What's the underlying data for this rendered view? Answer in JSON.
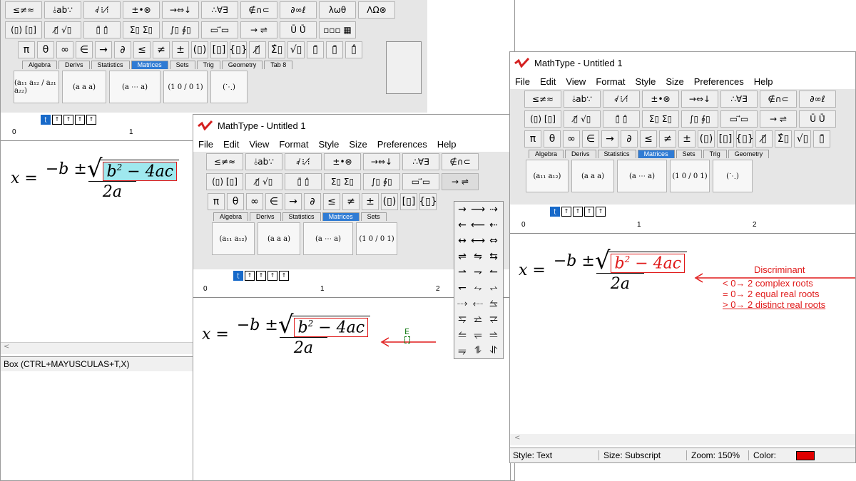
{
  "menu": [
    "File",
    "Edit",
    "View",
    "Format",
    "Style",
    "Size",
    "Preferences",
    "Help"
  ],
  "toolbar_row1": [
    "≤≠≈",
    "⫰ab∵",
    "⸗̸ ⁝ ⁝̸",
    "±•⊗",
    "→⇔↓",
    "∴∀∃",
    "∉∩⊂",
    "∂∞ℓ",
    "λωθ",
    "ΛΩ⊗"
  ],
  "toolbar_row2": [
    "(▯) [▯]",
    "▯̸ √▯",
    "▯̄ ▯̂",
    "Σ▯ Σ▯",
    "∫▯ ∮▯",
    "▭ ⃗▭",
    "→ ⇌",
    "Ū Ū̇",
    "▫▫▫ ▦"
  ],
  "toolbar_row3": [
    "π",
    "θ",
    "∞",
    "∈",
    "→",
    "∂",
    "≤",
    "≠",
    "±",
    "(▯)",
    "[▯]",
    "{▯}",
    "▯̸",
    "Σ̂▯",
    "√▯",
    "▯̄",
    "▯̄",
    "▯̂"
  ],
  "tabs": [
    "Algebra",
    "Derivs",
    "Statistics",
    "Matrices",
    "Sets",
    "Trig",
    "Geometry",
    "Tab 8"
  ],
  "active_tab": "Matrices",
  "equation": {
    "x": "x",
    "eq": "=",
    "neg_b": "−b ± ",
    "b": "b",
    "sup": "2",
    "rest": " − 4ac",
    "den": "2a"
  },
  "left_window": {
    "status": "Box (CTRL+MAYUSCULAS+T,X)"
  },
  "mid_window": {
    "title": "MathType - Untitled 1",
    "cursor_label": "E"
  },
  "right_window": {
    "title": "MathType - Untitled 1",
    "annotation_title": "Discriminant",
    "annotation_lines": [
      "< 0→ 2 complex roots",
      "= 0→ 2 equal real roots",
      "> 0→ 2 distinct real roots"
    ],
    "status": {
      "style": "Style: Text",
      "size": "Size: Subscript",
      "zoom": "Zoom: 150%",
      "color_label": "Color:"
    },
    "status_color": "#e00000"
  },
  "ruler_numbers": [
    "0",
    "1",
    "2"
  ],
  "arrow_panel": [
    "→",
    "⟶",
    "⇢",
    "←",
    "⟵",
    "⇠",
    "↔",
    "⟷",
    "⇔",
    "⇌",
    "⇋",
    "⇆",
    "⇀",
    "⇁",
    "↼",
    "↽",
    "⥊",
    "⥋",
    "⤏",
    "⤎",
    "⥦",
    "⥧",
    "⥨",
    "⥩",
    "⥪",
    "⥫",
    "⥬",
    "⥭",
    "⥮",
    "⥯"
  ],
  "accent": "#2f7bd4",
  "highlight": "#9fe8ee",
  "red": "#e01a1a"
}
